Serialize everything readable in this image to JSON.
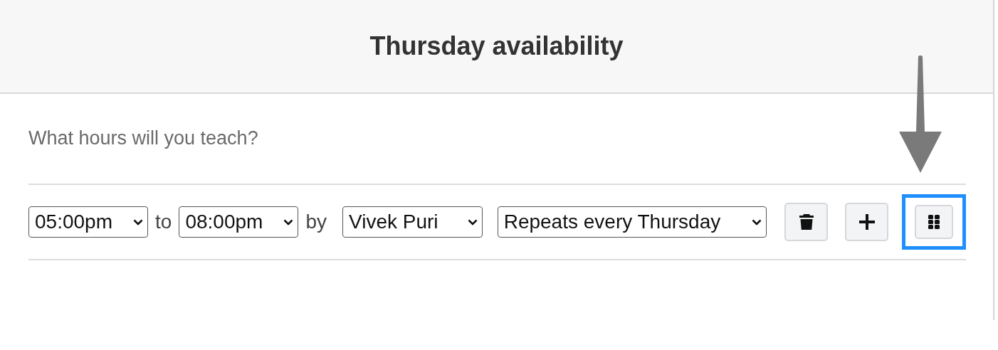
{
  "dialog": {
    "title": "Thursday availability"
  },
  "question": "What hours will you teach?",
  "slot": {
    "start": "05:00pm",
    "to_label": "to",
    "end": "08:00pm",
    "by_label": "by",
    "teacher": "Vivek Puri",
    "repeat": "Repeats every Thursday"
  },
  "buttons": [
    {
      "kind": "delete",
      "highlighted": false
    },
    {
      "kind": "add",
      "highlighted": false
    },
    {
      "kind": "drag",
      "highlighted": true
    }
  ]
}
